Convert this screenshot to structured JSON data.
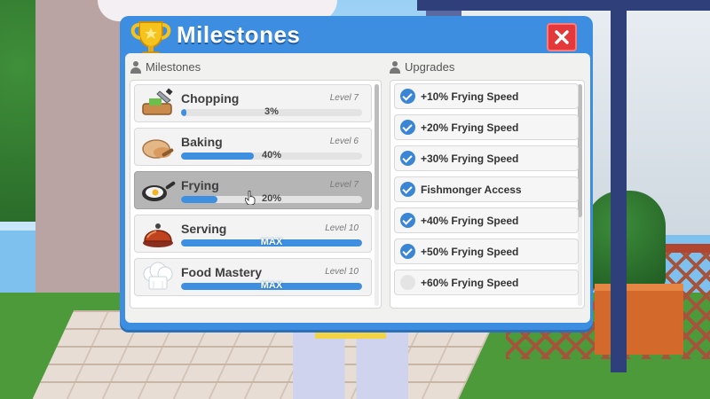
{
  "window": {
    "title": "Milestones",
    "close_label": "✕"
  },
  "milestones_panel": {
    "heading": "Milestones",
    "items": [
      {
        "name": "Chopping",
        "level": "Level 7",
        "progress_text": "3%",
        "progress": 0.03,
        "selected": false,
        "icon": "cutting-board-icon"
      },
      {
        "name": "Baking",
        "level": "Level 6",
        "progress_text": "40%",
        "progress": 0.4,
        "selected": false,
        "icon": "bread-icon"
      },
      {
        "name": "Frying",
        "level": "Level 7",
        "progress_text": "20%",
        "progress": 0.2,
        "selected": true,
        "icon": "frying-pan-icon"
      },
      {
        "name": "Serving",
        "level": "Level 10",
        "progress_text": "MAX",
        "progress": 1.0,
        "selected": false,
        "icon": "serving-cloche-icon"
      },
      {
        "name": "Food Mastery",
        "level": "Level 10",
        "progress_text": "MAX",
        "progress": 1.0,
        "selected": false,
        "icon": "chef-hat-icon"
      }
    ]
  },
  "upgrades_panel": {
    "heading": "Upgrades",
    "items": [
      {
        "label": "+10% Frying Speed",
        "unlocked": true
      },
      {
        "label": "+20% Frying Speed",
        "unlocked": true
      },
      {
        "label": "+30% Frying Speed",
        "unlocked": true
      },
      {
        "label": "Fishmonger Access",
        "unlocked": true
      },
      {
        "label": "+40% Frying Speed",
        "unlocked": true
      },
      {
        "label": "+50% Frying Speed",
        "unlocked": true
      },
      {
        "label": "+60% Frying Speed",
        "unlocked": false
      }
    ]
  },
  "colors": {
    "window_blue": "#3d8ee0",
    "progress_blue": "#3f8fe0",
    "close_red": "#e3393a",
    "selected_grey": "#b5b5b5"
  }
}
